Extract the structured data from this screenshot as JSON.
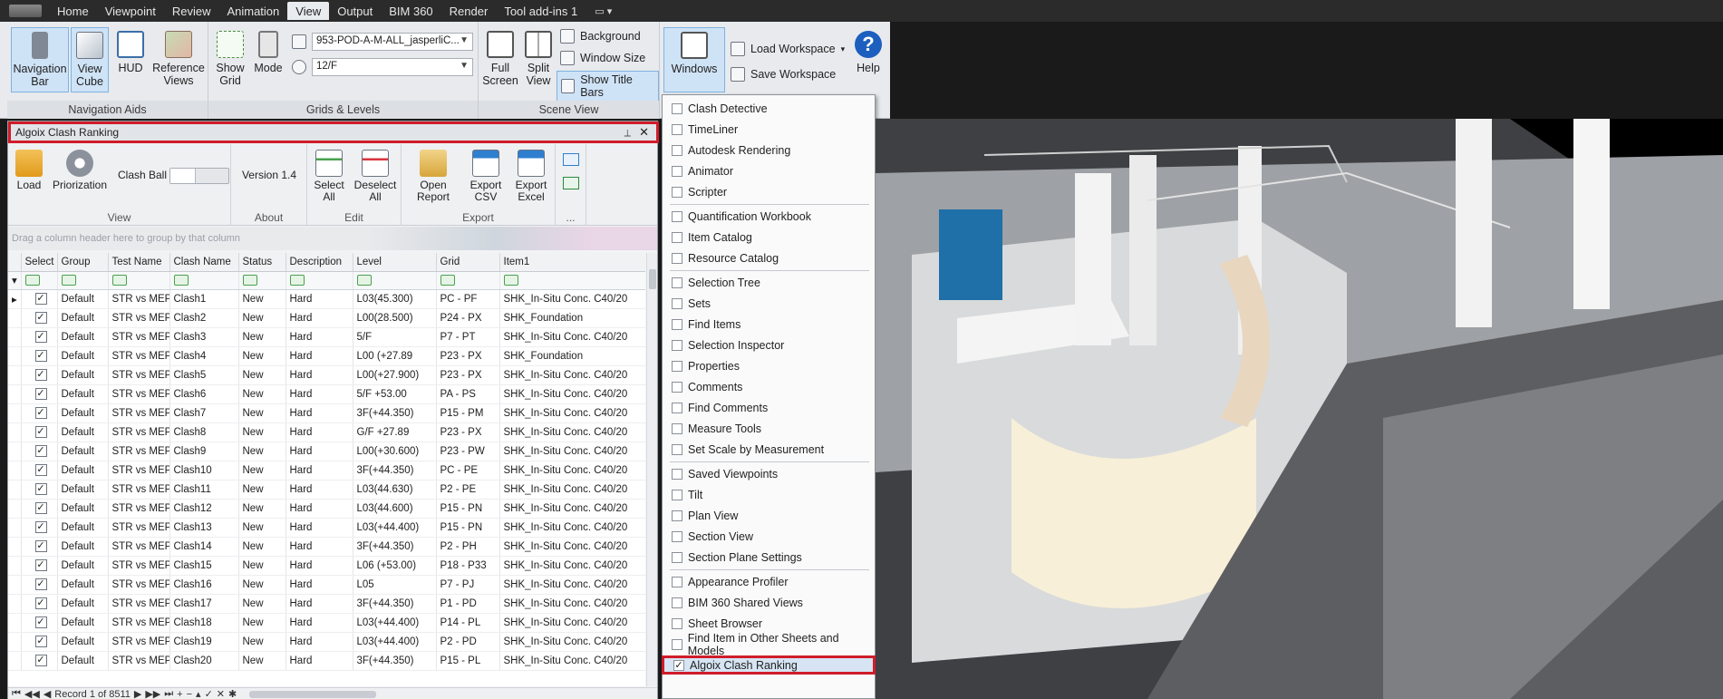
{
  "menubar": {
    "tabs": [
      "Home",
      "Viewpoint",
      "Review",
      "Animation",
      "View",
      "Output",
      "BIM 360",
      "Render",
      "Tool add-ins 1"
    ],
    "active_tab": "View"
  },
  "ribbon": {
    "navigation_aids": {
      "title": "Navigation Aids",
      "navigation_bar": "Navigation Bar",
      "view_cube": "View Cube",
      "hud": "HUD",
      "reference_views": "Reference Views"
    },
    "grids_levels": {
      "title": "Grids & Levels",
      "show_grid": "Show Grid",
      "mode": "Mode",
      "model_combo": "953-POD-A-M-ALL_jasperliC...",
      "level_combo": "12/F"
    },
    "scene_view": {
      "title": "Scene View",
      "full_screen": "Full Screen",
      "split_view": "Split View",
      "background": "Background",
      "window_size": "Window Size",
      "show_title_bars": "Show Title Bars"
    },
    "workspace": {
      "windows": "Windows",
      "load_workspace": "Load Workspace",
      "save_workspace": "Save Workspace",
      "help": "Help"
    }
  },
  "panel": {
    "title": "Algoix Clash Ranking",
    "toolbar": {
      "view_group": "View",
      "load": "Load",
      "priorization": "Priorization",
      "clash_ball": "Clash Ball",
      "about_group": "About",
      "version": "Version 1.4",
      "edit_group": "Edit",
      "select_all": "Select All",
      "deselect_all": "Deselect All",
      "export_group": "Export",
      "open_report": "Open Report",
      "export_csv": "Export CSV",
      "export_excel": "Export Excel",
      "more_group": "..."
    },
    "group_hint": "Drag a column header here to group by that column",
    "columns": [
      "Select",
      "Group",
      "Test Name",
      "Clash Name",
      "Status",
      "Description",
      "Level",
      "Grid",
      "Item1"
    ],
    "rows": [
      [
        "Default",
        "STR vs MEP",
        "Clash1",
        "New",
        "Hard",
        "L03(45.300)",
        "PC - PF",
        "SHK_In-Situ Conc. C40/20"
      ],
      [
        "Default",
        "STR vs MEP",
        "Clash2",
        "New",
        "Hard",
        "L00(28.500)",
        "P24 - PX",
        "SHK_Foundation"
      ],
      [
        "Default",
        "STR vs MEP",
        "Clash3",
        "New",
        "Hard",
        "5/F",
        "P7 - PT",
        "SHK_In-Situ Conc. C40/20"
      ],
      [
        "Default",
        "STR vs MEP",
        "Clash4",
        "New",
        "Hard",
        "L00 (+27.89",
        "P23 - PX",
        "SHK_Foundation"
      ],
      [
        "Default",
        "STR vs MEP",
        "Clash5",
        "New",
        "Hard",
        "L00(+27.900)",
        "P23 - PX",
        "SHK_In-Situ Conc. C40/20"
      ],
      [
        "Default",
        "STR vs MEP",
        "Clash6",
        "New",
        "Hard",
        "5/F +53.00",
        "PA - PS",
        "SHK_In-Situ Conc. C40/20"
      ],
      [
        "Default",
        "STR vs MEP",
        "Clash7",
        "New",
        "Hard",
        "3F(+44.350)",
        "P15 - PM",
        "SHK_In-Situ Conc. C40/20"
      ],
      [
        "Default",
        "STR vs MEP",
        "Clash8",
        "New",
        "Hard",
        "G/F +27.89",
        "P23 - PX",
        "SHK_In-Situ Conc. C40/20"
      ],
      [
        "Default",
        "STR vs MEP",
        "Clash9",
        "New",
        "Hard",
        "L00(+30.600)",
        "P23 - PW",
        "SHK_In-Situ Conc. C40/20"
      ],
      [
        "Default",
        "STR vs MEP",
        "Clash10",
        "New",
        "Hard",
        "3F(+44.350)",
        "PC - PE",
        "SHK_In-Situ Conc. C40/20"
      ],
      [
        "Default",
        "STR vs MEP",
        "Clash11",
        "New",
        "Hard",
        "L03(44.630)",
        "P2 - PE",
        "SHK_In-Situ Conc. C40/20"
      ],
      [
        "Default",
        "STR vs MEP",
        "Clash12",
        "New",
        "Hard",
        "L03(44.600)",
        "P15 - PN",
        "SHK_In-Situ Conc. C40/20"
      ],
      [
        "Default",
        "STR vs MEP",
        "Clash13",
        "New",
        "Hard",
        "L03(+44.400)",
        "P15 - PN",
        "SHK_In-Situ Conc. C40/20"
      ],
      [
        "Default",
        "STR vs MEP",
        "Clash14",
        "New",
        "Hard",
        "3F(+44.350)",
        "P2 - PH",
        "SHK_In-Situ Conc. C40/20"
      ],
      [
        "Default",
        "STR vs MEP",
        "Clash15",
        "New",
        "Hard",
        "L06 (+53.00)",
        "P18 - P33",
        "SHK_In-Situ Conc. C40/20"
      ],
      [
        "Default",
        "STR vs MEP",
        "Clash16",
        "New",
        "Hard",
        "L05",
        "P7 - PJ",
        "SHK_In-Situ Conc. C40/20"
      ],
      [
        "Default",
        "STR vs MEP",
        "Clash17",
        "New",
        "Hard",
        "3F(+44.350)",
        "P1 - PD",
        "SHK_In-Situ Conc. C40/20"
      ],
      [
        "Default",
        "STR vs MEP",
        "Clash18",
        "New",
        "Hard",
        "L03(+44.400)",
        "P14 - PL",
        "SHK_In-Situ Conc. C40/20"
      ],
      [
        "Default",
        "STR vs MEP",
        "Clash19",
        "New",
        "Hard",
        "L03(+44.400)",
        "P2 - PD",
        "SHK_In-Situ Conc. C40/20"
      ],
      [
        "Default",
        "STR vs MEP",
        "Clash20",
        "New",
        "Hard",
        "3F(+44.350)",
        "P15 - PL",
        "SHK_In-Situ Conc. C40/20"
      ]
    ],
    "record_text": "Record 1 of 8511"
  },
  "windows_menu": {
    "groups": [
      [
        "Clash Detective",
        "TimeLiner",
        "Autodesk Rendering",
        "Animator",
        "Scripter"
      ],
      [
        "Quantification Workbook",
        "Item Catalog",
        "Resource Catalog"
      ],
      [
        "Selection Tree",
        "Sets",
        "Find Items",
        "Selection Inspector",
        "Properties",
        "Comments",
        "Find Comments",
        "Measure Tools",
        "Set Scale by Measurement"
      ],
      [
        "Saved Viewpoints",
        "Tilt",
        "Plan View",
        "Section View",
        "Section Plane Settings"
      ],
      [
        "Appearance Profiler",
        "BIM 360 Shared Views",
        "Sheet Browser",
        "Find Item in Other Sheets and Models",
        "Algoix Clash Ranking"
      ]
    ],
    "checked_item": "Algoix Clash Ranking"
  },
  "colors": {
    "highlight_red": "#d01c2a",
    "selection_blue": "#cfe3f7",
    "filter_green": "#4aa050",
    "help_blue": "#1c5fbf"
  }
}
